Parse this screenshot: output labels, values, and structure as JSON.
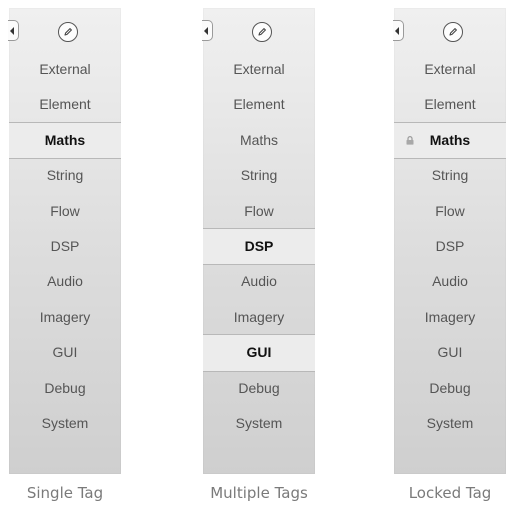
{
  "panels": [
    {
      "caption": "Single Tag",
      "tags": [
        {
          "label": "External"
        },
        {
          "label": "Element"
        },
        {
          "label": "Maths",
          "selected": true
        },
        {
          "label": "String"
        },
        {
          "label": "Flow"
        },
        {
          "label": "DSP"
        },
        {
          "label": "Audio"
        },
        {
          "label": "Imagery"
        },
        {
          "label": "GUI"
        },
        {
          "label": "Debug"
        },
        {
          "label": "System"
        }
      ]
    },
    {
      "caption": "Multiple Tags",
      "tags": [
        {
          "label": "External"
        },
        {
          "label": "Element"
        },
        {
          "label": "Maths"
        },
        {
          "label": "String"
        },
        {
          "label": "Flow"
        },
        {
          "label": "DSP",
          "selected": true
        },
        {
          "label": "Audio"
        },
        {
          "label": "Imagery"
        },
        {
          "label": "GUI",
          "selected": true
        },
        {
          "label": "Debug"
        },
        {
          "label": "System"
        }
      ]
    },
    {
      "caption": "Locked Tag",
      "tags": [
        {
          "label": "External"
        },
        {
          "label": "Element"
        },
        {
          "label": "Maths",
          "locked": true
        },
        {
          "label": "String"
        },
        {
          "label": "Flow"
        },
        {
          "label": "DSP"
        },
        {
          "label": "Audio"
        },
        {
          "label": "Imagery"
        },
        {
          "label": "GUI"
        },
        {
          "label": "Debug"
        },
        {
          "label": "System"
        }
      ]
    }
  ],
  "icons": {
    "collapse": "chevron-left-icon",
    "edit": "pencil-icon",
    "lock": "lock-icon"
  }
}
